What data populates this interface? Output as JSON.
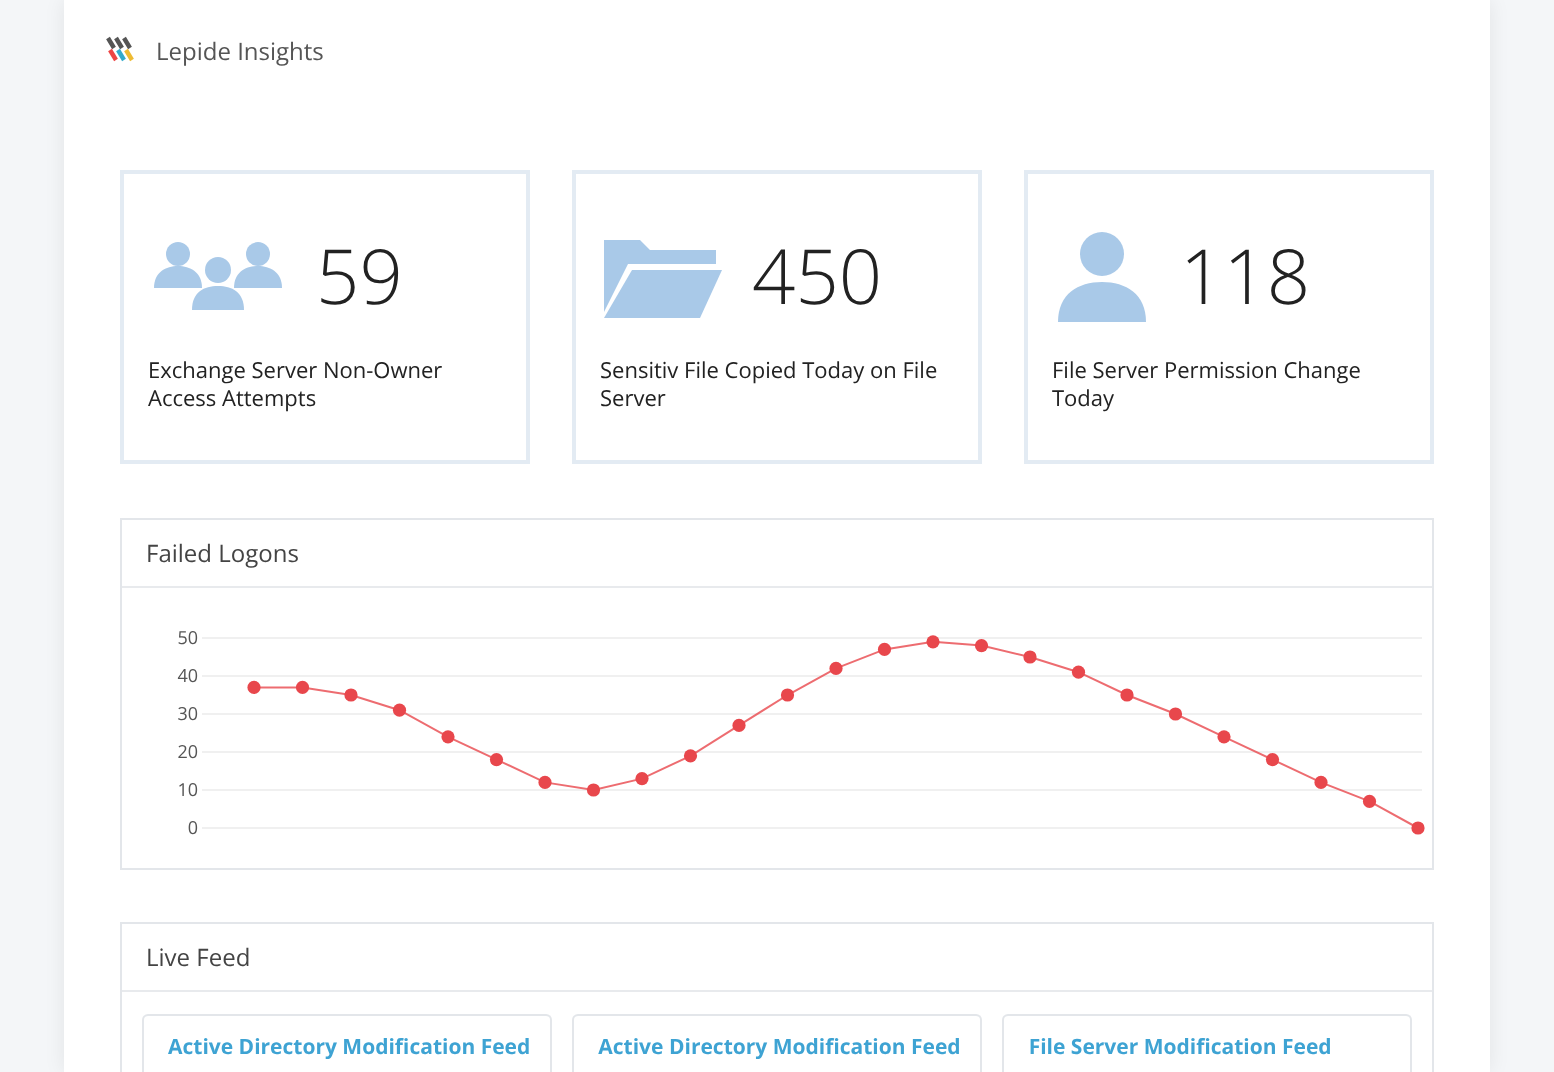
{
  "header": {
    "title": "Lepide Insights"
  },
  "stats": [
    {
      "kind": "users",
      "value": "59",
      "label": "Exchange Server Non-Owner Access Attempts"
    },
    {
      "kind": "folder",
      "value": "450",
      "label": "Sensitiv File Copied Today on File Server"
    },
    {
      "kind": "user",
      "value": "118",
      "label": "File Server Permission Change Today"
    }
  ],
  "failed_logons": {
    "title": "Failed Logons",
    "chart_data": {
      "type": "line",
      "grid": true,
      "ylim": [
        0,
        50
      ],
      "yticks": [
        0,
        10,
        20,
        30,
        40,
        50
      ],
      "series": [
        {
          "color": "#e8474c",
          "marker": true,
          "values": [
            37,
            37,
            35,
            31,
            24,
            18,
            12,
            10,
            13,
            19,
            27,
            35,
            42,
            47,
            49,
            48,
            45,
            41,
            35,
            30,
            24,
            18,
            12,
            7,
            0
          ]
        }
      ]
    }
  },
  "live_feed": {
    "title": "Live Feed",
    "feeds": [
      "Active Directory Modification Feed",
      "Active Directory Modification Feed",
      "File Server Modification Feed"
    ]
  }
}
